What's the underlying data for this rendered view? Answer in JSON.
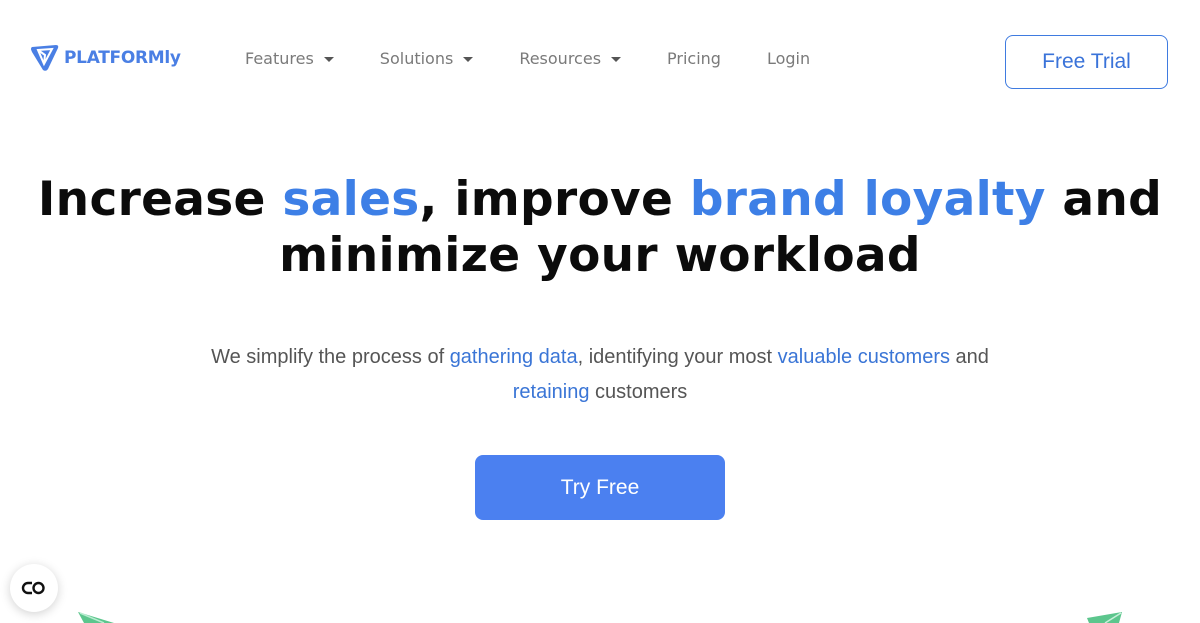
{
  "header": {
    "logo_text": "PLATFORMly",
    "nav": [
      {
        "label": "Features",
        "has_dropdown": true
      },
      {
        "label": "Solutions",
        "has_dropdown": true
      },
      {
        "label": "Resources",
        "has_dropdown": true
      },
      {
        "label": "Pricing",
        "has_dropdown": false
      },
      {
        "label": "Login",
        "has_dropdown": false
      }
    ],
    "cta_label": "Free Trial"
  },
  "hero": {
    "title": {
      "part1": "Increase ",
      "highlight1": "sales",
      "part2": ", improve ",
      "highlight2": "brand loyalty",
      "part3": " and",
      "line2": "minimize your workload"
    },
    "subtitle": {
      "part1": "We simplify the process of ",
      "link1": "gathering data",
      "part2": ", identifying your most ",
      "link2": "valuable customers",
      "part3": " and",
      "link3": "retaining",
      "part4": " customers"
    },
    "cta_label": "Try Free"
  },
  "widgets": {
    "floating_icon": "accessibility-toggle-icon",
    "decoration_icon": "paper-plane-icon"
  },
  "colors": {
    "brand": "#4a7fe4",
    "highlight": "#3d7fe6",
    "primary_button": "#4b80f0",
    "decoration": "#5cc68d"
  }
}
